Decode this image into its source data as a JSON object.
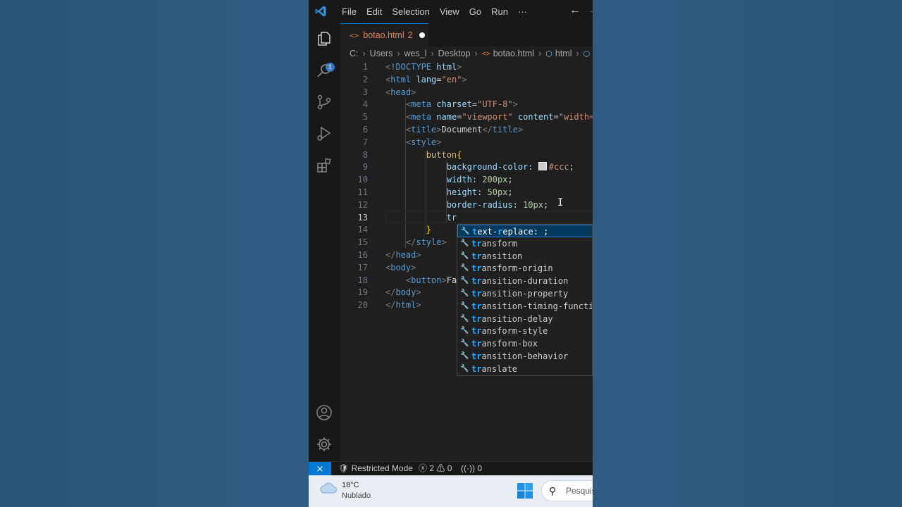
{
  "menu": [
    "File",
    "Edit",
    "Selection",
    "View",
    "Go",
    "Run",
    "···"
  ],
  "nav": {
    "back": "←",
    "forward": "→"
  },
  "activity": {
    "explorer_badge": "1"
  },
  "tab": {
    "icon": "<>",
    "label": "botao.html",
    "problems": "2"
  },
  "breadcrumb": [
    "C:",
    "Users",
    "wes_l",
    "Desktop",
    "botao.html",
    "html"
  ],
  "editor": {
    "line_numbers": [
      "1",
      "2",
      "3",
      "4",
      "5",
      "6",
      "7",
      "8",
      "9",
      "10",
      "11",
      "12",
      "13",
      "14",
      "15",
      "16",
      "17",
      "18",
      "19",
      "20"
    ],
    "active_line": 13,
    "lines": [
      [
        [
          "t-br",
          "<"
        ],
        [
          "t-tag",
          "!DOCTYPE"
        ],
        [
          "t-txt",
          " "
        ],
        [
          "t-attr",
          "html"
        ],
        [
          "t-br",
          ">"
        ]
      ],
      [
        [
          "t-br",
          "<"
        ],
        [
          "t-tag",
          "html"
        ],
        [
          "t-txt",
          " "
        ],
        [
          "t-attr",
          "lang"
        ],
        [
          "t-txt",
          "="
        ],
        [
          "t-str",
          "\"en\""
        ],
        [
          "t-br",
          ">"
        ]
      ],
      [
        [
          "t-br",
          "<"
        ],
        [
          "t-tag",
          "head"
        ],
        [
          "t-br",
          ">"
        ]
      ],
      [
        [
          "t-txt",
          "    "
        ],
        [
          "t-br",
          "<"
        ],
        [
          "t-tag",
          "meta"
        ],
        [
          "t-txt",
          " "
        ],
        [
          "t-attr",
          "charset"
        ],
        [
          "t-txt",
          "="
        ],
        [
          "t-str",
          "\"UTF-8\""
        ],
        [
          "t-br",
          ">"
        ]
      ],
      [
        [
          "t-txt",
          "    "
        ],
        [
          "t-br",
          "<"
        ],
        [
          "t-tag",
          "meta"
        ],
        [
          "t-txt",
          " "
        ],
        [
          "t-attr",
          "name"
        ],
        [
          "t-txt",
          "="
        ],
        [
          "t-str",
          "\"viewport\""
        ],
        [
          "t-txt",
          " "
        ],
        [
          "t-attr",
          "content"
        ],
        [
          "t-txt",
          "="
        ],
        [
          "t-str",
          "\"width="
        ]
      ],
      [
        [
          "t-txt",
          "    "
        ],
        [
          "t-br",
          "<"
        ],
        [
          "t-tag",
          "title"
        ],
        [
          "t-br",
          ">"
        ],
        [
          "t-txt",
          "Document"
        ],
        [
          "t-br",
          "</"
        ],
        [
          "t-tag",
          "title"
        ],
        [
          "t-br",
          ">"
        ]
      ],
      [
        [
          "t-txt",
          "    "
        ],
        [
          "t-br",
          "<"
        ],
        [
          "t-tag",
          "style"
        ],
        [
          "t-br",
          ">"
        ]
      ],
      [
        [
          "t-txt",
          "        "
        ],
        [
          "t-sel",
          "button"
        ],
        [
          "t-brace",
          "{"
        ]
      ],
      [
        [
          "t-txt",
          "            "
        ],
        [
          "t-prop",
          "background-color"
        ],
        [
          "t-txt",
          ": "
        ],
        [
          "swatch",
          ""
        ],
        [
          "t-str",
          "#ccc"
        ],
        [
          "t-txt",
          ";"
        ]
      ],
      [
        [
          "t-txt",
          "            "
        ],
        [
          "t-prop",
          "width"
        ],
        [
          "t-txt",
          ": "
        ],
        [
          "t-num",
          "200px"
        ],
        [
          "t-txt",
          ";"
        ]
      ],
      [
        [
          "t-txt",
          "            "
        ],
        [
          "t-prop",
          "height"
        ],
        [
          "t-txt",
          ": "
        ],
        [
          "t-num",
          "50px"
        ],
        [
          "t-txt",
          ";"
        ]
      ],
      [
        [
          "t-txt",
          "            "
        ],
        [
          "t-prop",
          "border-radius"
        ],
        [
          "t-txt",
          ": "
        ],
        [
          "t-num",
          "10px"
        ],
        [
          "t-txt",
          ";"
        ]
      ],
      [
        [
          "t-txt",
          "            "
        ],
        [
          "t-prop",
          "tr"
        ]
      ],
      [
        [
          "t-txt",
          "        "
        ],
        [
          "t-brace",
          "}"
        ]
      ],
      [
        [
          "t-txt",
          "    "
        ],
        [
          "t-br",
          "</"
        ],
        [
          "t-tag",
          "style"
        ],
        [
          "t-br",
          ">"
        ]
      ],
      [
        [
          "t-br",
          "</"
        ],
        [
          "t-tag",
          "head"
        ],
        [
          "t-br",
          ">"
        ]
      ],
      [
        [
          "t-br",
          "<"
        ],
        [
          "t-tag",
          "body"
        ],
        [
          "t-br",
          ">"
        ]
      ],
      [
        [
          "t-txt",
          "    "
        ],
        [
          "t-br",
          "<"
        ],
        [
          "t-tag",
          "button"
        ],
        [
          "t-br",
          ">"
        ],
        [
          "t-txt",
          "Fa"
        ]
      ],
      [
        [
          "t-br",
          "</"
        ],
        [
          "t-tag",
          "body"
        ],
        [
          "t-br",
          ">"
        ]
      ],
      [
        [
          "t-br",
          "</"
        ],
        [
          "t-tag",
          "html"
        ],
        [
          "t-br",
          ">"
        ]
      ]
    ]
  },
  "suggestions": [
    {
      "label": "text-replace: ;",
      "selected": true
    },
    {
      "label": "transform"
    },
    {
      "label": "transition"
    },
    {
      "label": "transform-origin"
    },
    {
      "label": "transition-duration"
    },
    {
      "label": "transition-property"
    },
    {
      "label": "transition-timing-functi"
    },
    {
      "label": "transition-delay"
    },
    {
      "label": "transform-style"
    },
    {
      "label": "transform-box"
    },
    {
      "label": "transition-behavior"
    },
    {
      "label": "translate"
    }
  ],
  "status": {
    "remote_icon": "remote-icon",
    "restricted": "Restricted Mode",
    "errors": "2",
    "warnings": "0",
    "ports": "0"
  },
  "taskbar": {
    "temperature": "18°C",
    "weather": "Nublado",
    "search_placeholder": "Pesquis"
  }
}
